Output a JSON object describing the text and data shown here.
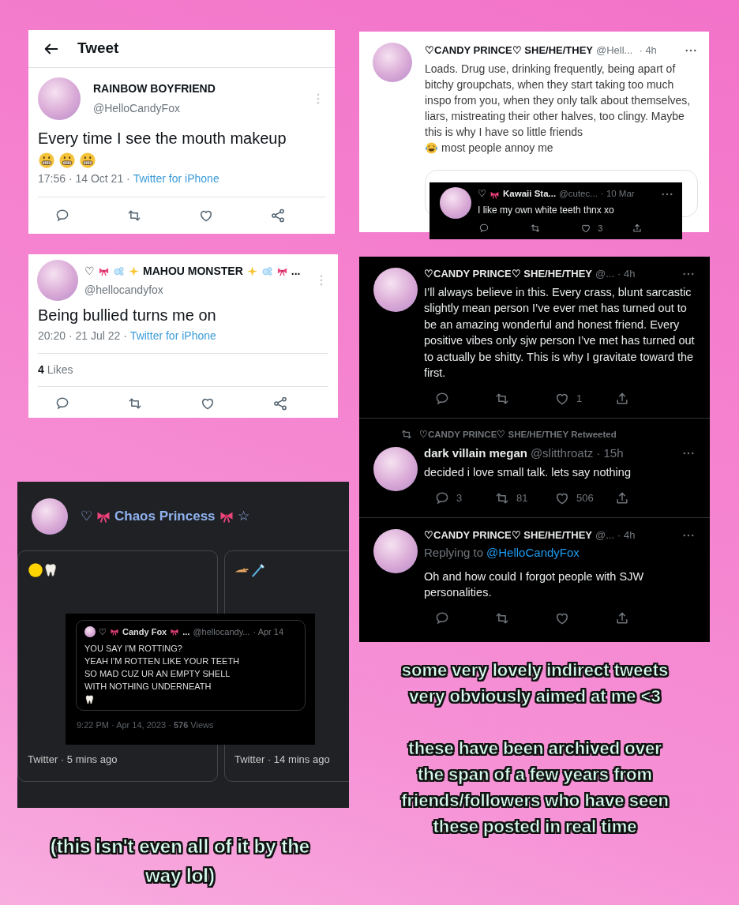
{
  "tweet_detail": {
    "title": "Tweet",
    "tweet": {
      "name_parts": [
        {
          "kind": "text",
          "text": "RAINBOW BOYFRIEND"
        }
      ],
      "handle": "@HelloCandyFox",
      "text": "Every time I see the mouth makeup",
      "text_emoji": [
        {
          "kind": "grimace"
        },
        {
          "kind": "grimace"
        },
        {
          "kind": "grimace"
        }
      ],
      "meta": "17:56 · 14 Oct 21 ·",
      "source": "Twitter for iPhone",
      "actions": [
        {
          "kind": "reply"
        },
        {
          "kind": "retweet"
        },
        {
          "kind": "like"
        },
        {
          "kind": "share"
        }
      ]
    }
  },
  "quote_reply": {
    "tweet": {
      "name_parts": [
        {
          "kind": "text",
          "text": "♡CANDY PRINCE♡ SHE/HE/THEY"
        }
      ],
      "handle": "@Hell...",
      "time": "· 4h",
      "text": "Loads. Drug use, drinking frequently, being apart of bitchy groupchats, when they start taking too much inspo from you, when they only talk about themselves, liars, mistreating their other halves, too clingy. Maybe this is why I have so little friends",
      "text_emoji": [
        {
          "kind": "laugh-cry"
        }
      ],
      "text_after": "most people annoy me"
    },
    "overlay": {
      "name_parts": [
        {
          "kind": "heart",
          "text": "♡"
        },
        {
          "kind": "bow"
        },
        {
          "kind": "text",
          "text": "Kawaii Sta..."
        }
      ],
      "handle": "@cutec...",
      "time": "· 10 Mar",
      "text": "I like my own white teeth thnx xo",
      "actions": [
        {
          "kind": "reply"
        },
        {
          "kind": "retweet"
        },
        {
          "kind": "like",
          "count": "3"
        },
        {
          "kind": "upload"
        }
      ]
    }
  },
  "liked_tweet": {
    "tweet": {
      "name_parts": [
        {
          "kind": "heart",
          "text": "♡"
        },
        {
          "kind": "bow"
        },
        {
          "kind": "bubbles"
        },
        {
          "kind": "sparkle"
        },
        {
          "kind": "text",
          "text": "MAHOU MONSTER"
        },
        {
          "kind": "sparkle"
        },
        {
          "kind": "bubbles"
        },
        {
          "kind": "bow"
        },
        {
          "kind": "ellipsis",
          "text": "..."
        }
      ],
      "handle": "@hellocandyfox",
      "text": "Being bullied turns me on",
      "meta": "20:20 · 21 Jul 22 ·",
      "source": "Twitter for iPhone",
      "likes_count": "4",
      "likes_label": "Likes",
      "actions": [
        {
          "kind": "reply"
        },
        {
          "kind": "retweet"
        },
        {
          "kind": "like"
        },
        {
          "kind": "share"
        }
      ]
    }
  },
  "dark_timeline": {
    "tweets": [
      {
        "name_parts": [
          {
            "kind": "text",
            "text": "♡CANDY PRINCE♡ SHE/HE/THEY"
          }
        ],
        "handle": "@...",
        "time": "· 4h",
        "text": "I’ll always believe in this. Every crass, blunt sarcastic slightly mean person I’ve ever met has turned out to be an amazing wonderful and honest friend. Every positive vibes only sjw person I’ve met has turned out to actually be shitty. This is why I gravitate toward the first.",
        "actions": [
          {
            "kind": "reply"
          },
          {
            "kind": "retweet"
          },
          {
            "kind": "like",
            "count": "1"
          },
          {
            "kind": "upload"
          }
        ]
      },
      {
        "retweeted_by": "♡CANDY PRINCE♡ SHE/HE/THEY Retweeted",
        "name_parts": [
          {
            "kind": "text",
            "text": "dark villain megan"
          }
        ],
        "handle": "@slitthroatz",
        "time": "· 15h",
        "text": "decided i love small talk. lets say nothing",
        "actions": [
          {
            "kind": "reply",
            "count": "3"
          },
          {
            "kind": "retweet",
            "count": "81"
          },
          {
            "kind": "like",
            "count": "506"
          },
          {
            "kind": "upload"
          }
        ]
      },
      {
        "name_parts": [
          {
            "kind": "text",
            "text": "♡CANDY PRINCE♡ SHE/HE/THEY"
          }
        ],
        "handle": "@...",
        "time": "· 4h",
        "replying_prefix": "Replying to",
        "replying_to": "@HelloCandyFox",
        "text": "Oh and how could I forgot people with SJW personalities.",
        "actions": [
          {
            "kind": "reply"
          },
          {
            "kind": "retweet"
          },
          {
            "kind": "like"
          },
          {
            "kind": "upload"
          }
        ]
      }
    ]
  },
  "chaos_feed": {
    "header": {
      "name_parts": [
        {
          "kind": "heart",
          "text": "♡"
        },
        {
          "kind": "bow"
        },
        {
          "kind": "text",
          "text": "Chaos Princess"
        },
        {
          "kind": "bow"
        },
        {
          "kind": "star",
          "text": "☆"
        }
      ]
    },
    "cards": [
      {
        "emoji": [
          {
            "kind": "yellow-circle"
          },
          {
            "kind": "tooth"
          }
        ],
        "footer": "Twitter · 5 mins ago"
      },
      {
        "emoji": [
          {
            "kind": "hand"
          },
          {
            "kind": "toothbrush"
          }
        ],
        "footer": "Twitter · 14 mins ago"
      }
    ],
    "overlay": {
      "name_parts": [
        {
          "kind": "heart",
          "text": "♡"
        },
        {
          "kind": "bow"
        },
        {
          "kind": "text",
          "text": "Candy Fox"
        },
        {
          "kind": "bow"
        },
        {
          "kind": "ellipsis",
          "text": "..."
        }
      ],
      "handle": "@hellocandy...",
      "time": "· Apr 14",
      "text": "YOU SAY I'M ROTTING?\nYEAH I'M ROTTEN LIKE YOUR TEETH\nSO MAD CUZ UR AN EMPTY SHELL\nWITH NOTHING UNDERNEATH",
      "text_emoji": [
        {
          "kind": "tooth"
        }
      ],
      "footer": "9:22 PM · Apr 14, 2023 · **576** Views"
    }
  },
  "caption_right": [
    "some very lovely indirect tweets\nvery obviously aimed at me <3",
    "these have been archived over\nthe span of a few years from\nfriends/followers who have seen\nthese posted in real time"
  ],
  "caption_bottom": "(this isn't even all of it by the\nway lol)"
}
